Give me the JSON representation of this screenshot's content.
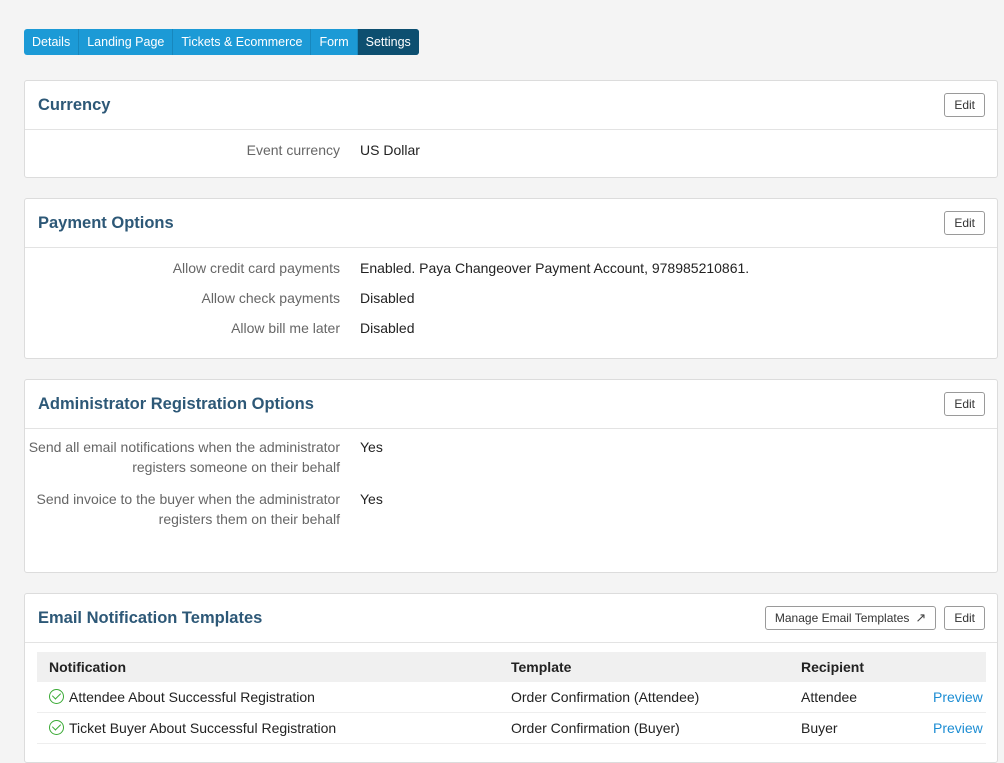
{
  "tabs": [
    "Details",
    "Landing Page",
    "Tickets & Ecommerce",
    "Form",
    "Settings"
  ],
  "currency": {
    "title": "Currency",
    "edit": "Edit",
    "rows": [
      {
        "label": "Event currency",
        "value": "US Dollar"
      }
    ]
  },
  "payment": {
    "title": "Payment Options",
    "edit": "Edit",
    "rows": [
      {
        "label": "Allow credit card payments",
        "value": "Enabled. Paya Changeover Payment Account, 978985210861."
      },
      {
        "label": "Allow check payments",
        "value": "Disabled"
      },
      {
        "label": "Allow bill me later",
        "value": "Disabled"
      }
    ]
  },
  "admin": {
    "title": "Administrator Registration Options",
    "edit": "Edit",
    "rows": [
      {
        "label": "Send all email notifications when the administrator registers someone on their behalf",
        "value": "Yes"
      },
      {
        "label": "Send invoice to the buyer when the administrator registers them on their behalf",
        "value": "Yes"
      }
    ]
  },
  "email": {
    "title": "Email Notification Templates",
    "manage": "Manage Email Templates",
    "edit": "Edit",
    "columns": [
      "Notification",
      "Template",
      "Recipient"
    ],
    "rows": [
      {
        "notification": "Attendee About Successful Registration",
        "template": "Order Confirmation (Attendee)",
        "recipient": "Attendee",
        "action": "Preview"
      },
      {
        "notification": "Ticket Buyer About Successful Registration",
        "template": "Order Confirmation (Buyer)",
        "recipient": "Buyer",
        "action": "Preview"
      }
    ]
  },
  "icons": {
    "status": "check-circle-icon",
    "external": "external-link-icon"
  },
  "colors": {
    "tab_bar": "#1c9ad6",
    "tab_active": "#0d4f70",
    "panel_title": "#2d5877",
    "link": "#1c8dd3",
    "check": "#3aaa35"
  }
}
